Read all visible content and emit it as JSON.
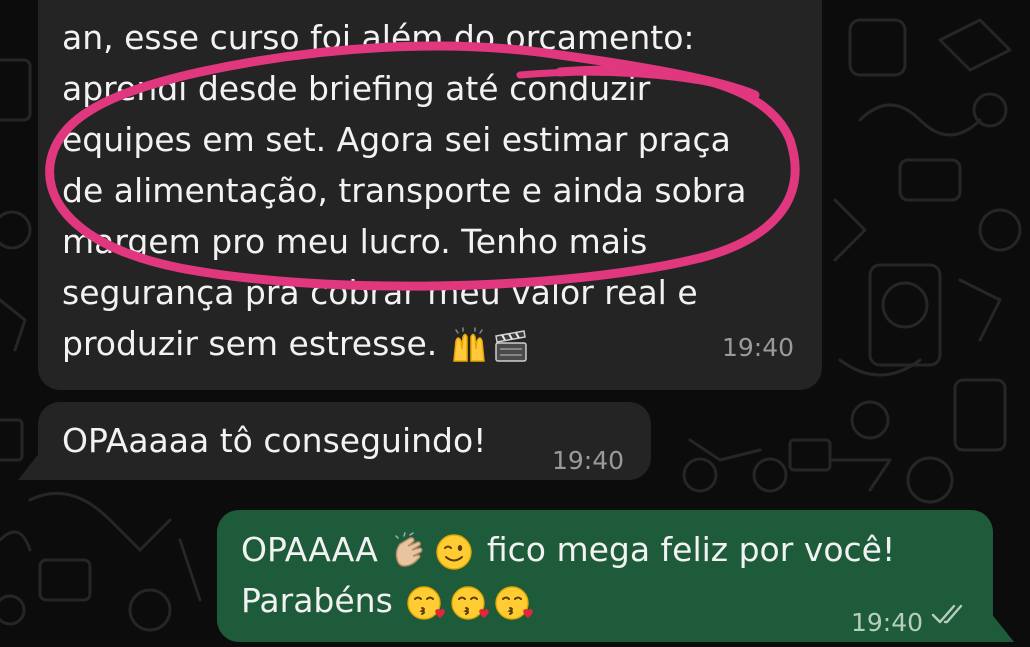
{
  "chat": {
    "wallpaper": "whatsapp-doodle-dark",
    "accent_out": "#1e5b3a",
    "accent_in": "#242424",
    "highlight_color": "#e0377f"
  },
  "messages": [
    {
      "direction": "incoming",
      "lines": [
        "an, esse curso foi além do orçamento:",
        "aprendi desde briefing até conduzir",
        "equipes em set. Agora sei estimar praça",
        "de alimentação, transporte e ainda sobra",
        "margem pro meu lucro. Tenho mais",
        "segurança pra cobrar meu valor real e",
        "produzir sem estresse."
      ],
      "emoji": [
        "raising-hands",
        "clapper-board"
      ],
      "time": "19:40",
      "annotation": "pink-hand-drawn-circle"
    },
    {
      "direction": "incoming",
      "lines": [
        "OPAaaaa tô conseguindo!"
      ],
      "time": "19:40"
    },
    {
      "direction": "outgoing",
      "line1_prefix": "OPAAAA",
      "line1_suffix": "fico mega feliz por você!",
      "line2": "Parabéns",
      "emoji_line1": [
        "clapping-hands",
        "winking-face"
      ],
      "emoji_line2": [
        "face-blowing-kiss",
        "face-blowing-kiss",
        "face-blowing-kiss"
      ],
      "time": "19:40",
      "status_icon": "double-check-icon"
    }
  ]
}
